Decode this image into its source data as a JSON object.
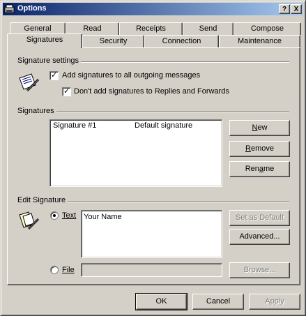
{
  "window": {
    "title": "Options"
  },
  "titlebar_buttons": {
    "help": "?",
    "close": "X"
  },
  "tabs_row1": [
    "General",
    "Read",
    "Receipts",
    "Send",
    "Compose"
  ],
  "tabs_row2": [
    "Signatures",
    "Security",
    "Connection",
    "Maintenance"
  ],
  "active_tab": "Signatures",
  "signature_settings": {
    "label": "Signature settings",
    "add_to_all": {
      "label": "Add signatures to all outgoing messages",
      "checked": true
    },
    "no_replies": {
      "label": "Don't add signatures to Replies and Forwards",
      "checked": true
    }
  },
  "signatures": {
    "label": "Signatures",
    "list": [
      {
        "name": "Signature #1",
        "description": "Default signature"
      }
    ],
    "buttons": {
      "new": "New",
      "remove": "Remove",
      "rename": "Rename"
    }
  },
  "edit_signature": {
    "label": "Edit Signature",
    "text_option": {
      "label": "Text",
      "selected": true
    },
    "text_value": "Your Name",
    "file_option": {
      "label": "File",
      "selected": false
    },
    "file_value": "",
    "buttons": {
      "set_default": "Set as Default",
      "advanced": "Advanced...",
      "browse": "Browse..."
    }
  },
  "footer_buttons": {
    "ok": "OK",
    "cancel": "Cancel",
    "apply": "Apply"
  }
}
